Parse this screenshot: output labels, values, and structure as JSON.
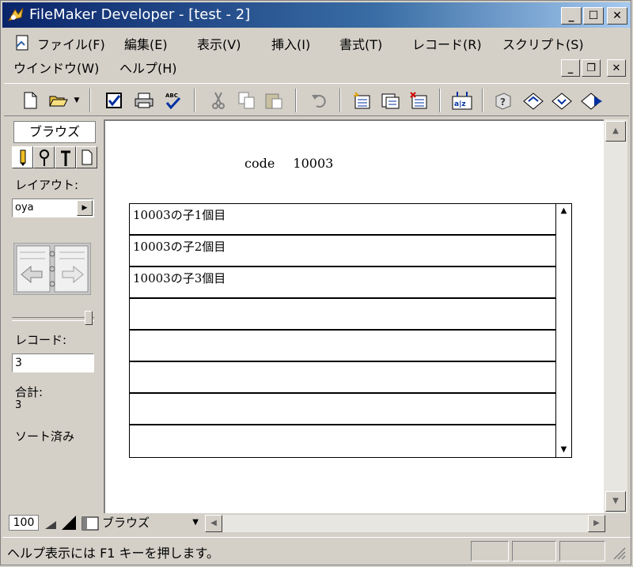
{
  "window": {
    "title": "FileMaker Developer - [test - 2]"
  },
  "menubar": {
    "row1": [
      "ファイル(F)",
      "編集(E)",
      "表示(V)",
      "挿入(I)",
      "書式(T)",
      "レコード(R)",
      "スクリプト(S)"
    ],
    "row2": [
      "ウインドウ(W)",
      "ヘルプ(H)"
    ]
  },
  "toolbar": {
    "icons": [
      "new-icon",
      "open-icon",
      "check-icon",
      "print-icon",
      "spell-check-icon",
      "cut-icon",
      "copy-icon",
      "paste-icon",
      "undo-icon",
      "new-record-icon",
      "duplicate-record-icon",
      "delete-record-icon",
      "sort-icon",
      "help-icon",
      "script-icon",
      "script-step-icon",
      "script-run-icon"
    ]
  },
  "panel": {
    "mode_tab": "ブラウズ",
    "layout_label": "レイアウト:",
    "layout_value": "oya",
    "record_label": "レコード:",
    "record_value": "3",
    "total_label": "合計:",
    "total_value": "3",
    "sorted_label": "ソート済み"
  },
  "content": {
    "code_label": "code",
    "code_value": "10003",
    "portal_rows": [
      "10003の子1個目",
      "10003の子2個目",
      "10003の子3個目",
      "",
      "",
      "",
      "",
      ""
    ]
  },
  "bottombar": {
    "zoom": "100",
    "mode": "ブラウズ"
  },
  "statusbar": {
    "text": "ヘルプ表示には F1 キーを押します。"
  },
  "colors": {
    "titlebar_start": "#0a246a",
    "titlebar_end": "#a6caf0",
    "chrome": "#d4d0c8"
  }
}
